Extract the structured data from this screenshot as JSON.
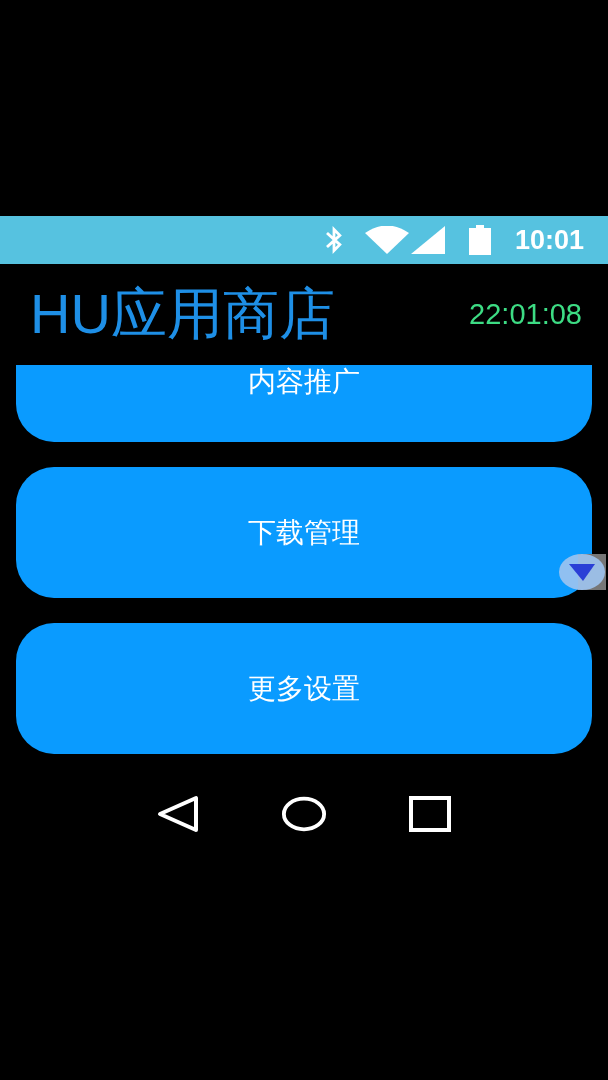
{
  "status_bar": {
    "time": "10:01"
  },
  "header": {
    "title": "HU应用商店",
    "clock": "22:01:08"
  },
  "menu_buttons": [
    {
      "label": "内容推广"
    },
    {
      "label": "下载管理"
    },
    {
      "label": "更多设置"
    }
  ]
}
